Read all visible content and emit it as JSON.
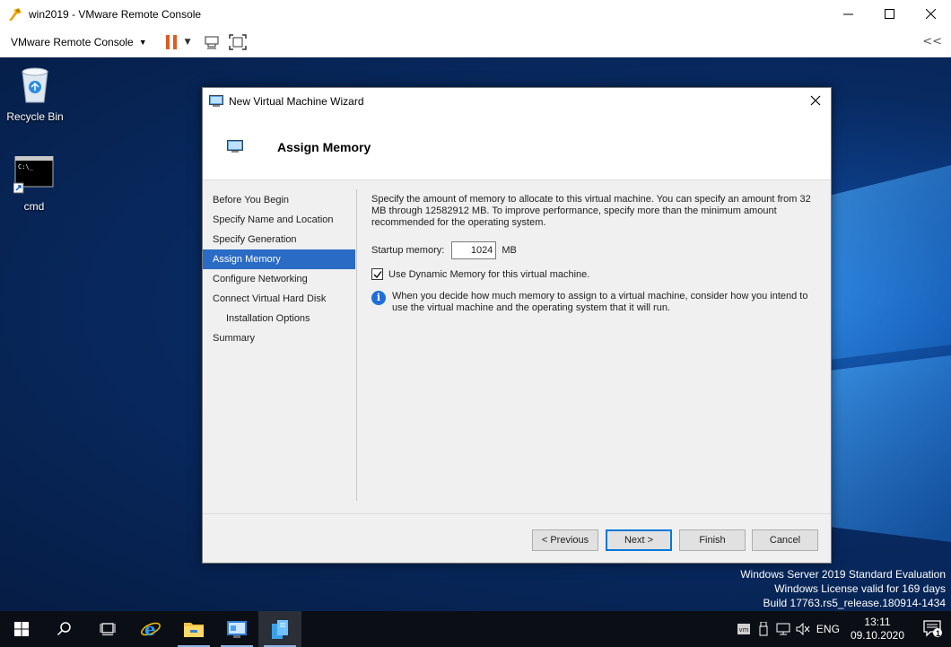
{
  "vmware": {
    "window_title": "win2019 - VMware Remote Console",
    "menu_label": "VMware Remote Console",
    "collapse_label": "<<"
  },
  "desktop": {
    "icons": [
      {
        "label": "Recycle Bin",
        "icon": "recycle-bin-icon"
      },
      {
        "label": "cmd",
        "icon": "cmd-icon"
      }
    ],
    "watermark": {
      "line1": "Windows Server 2019 Standard Evaluation",
      "line2": "Windows License valid for 169 days",
      "line3": "Build 17763.rs5_release.180914-1434"
    }
  },
  "wizard": {
    "title": "New Virtual Machine Wizard",
    "header": "Assign Memory",
    "nav": [
      {
        "label": "Before You Begin"
      },
      {
        "label": "Specify Name and Location"
      },
      {
        "label": "Specify Generation"
      },
      {
        "label": "Assign Memory",
        "active": true
      },
      {
        "label": "Configure Networking"
      },
      {
        "label": "Connect Virtual Hard Disk"
      },
      {
        "label": "Installation Options",
        "sub": true
      },
      {
        "label": "Summary"
      }
    ],
    "description": "Specify the amount of memory to allocate to this virtual machine. You can specify an amount from 32 MB through 12582912 MB. To improve performance, specify more than the minimum amount recommended for the operating system.",
    "startup_label": "Startup memory:",
    "startup_value": "1024",
    "startup_unit": "MB",
    "dynamic_label": "Use Dynamic Memory for this virtual machine.",
    "dynamic_checked": true,
    "info_text": "When you decide how much memory to assign to a virtual machine, consider how you intend to use the virtual machine and the operating system that it will run.",
    "buttons": {
      "previous": "< Previous",
      "next": "Next >",
      "finish": "Finish",
      "cancel": "Cancel"
    }
  },
  "taskbar": {
    "language": "ENG",
    "time": "13:11",
    "date": "09.10.2020",
    "notification_count": "1"
  }
}
